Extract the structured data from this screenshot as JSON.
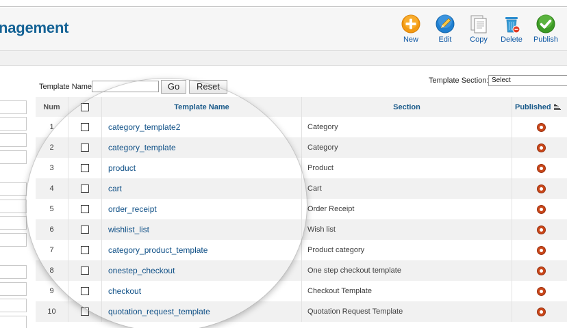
{
  "header": {
    "title": "nagement"
  },
  "toolbar": {
    "new_label": "New",
    "edit_label": "Edit",
    "copy_label": "Copy",
    "delete_label": "Delete",
    "publish_label": "Publish"
  },
  "filter": {
    "template_name_label": "Template Name:",
    "template_name_value": "",
    "go_label": "Go",
    "reset_label": "Reset",
    "section_label": "Template Section:",
    "section_selected": "Select"
  },
  "table": {
    "headers": {
      "num": "Num",
      "name": "Template Name",
      "section": "Section",
      "published": "Published"
    },
    "rows": [
      {
        "num": "1",
        "name": "category_template2",
        "section": "Category"
      },
      {
        "num": "2",
        "name": "category_template",
        "section": "Category"
      },
      {
        "num": "3",
        "name": "product",
        "section": "Product"
      },
      {
        "num": "4",
        "name": "cart",
        "section": "Cart"
      },
      {
        "num": "5",
        "name": "order_receipt",
        "section": "Order Receipt"
      },
      {
        "num": "6",
        "name": "wishlist_list",
        "section": "Wish list"
      },
      {
        "num": "7",
        "name": "category_product_template",
        "section": "Product category"
      },
      {
        "num": "8",
        "name": "onestep_checkout",
        "section": "One step checkout template"
      },
      {
        "num": "9",
        "name": "checkout",
        "section": "Checkout Template"
      },
      {
        "num": "10",
        "name": "quotation_request_template",
        "section": "Quotation Request Template"
      }
    ]
  },
  "colors": {
    "title": "#146295",
    "link": "#0e4f86",
    "published_dot": "#c9471a",
    "new_icon": "#f39a12",
    "edit_icon": "#1f7fd0",
    "delete_icon": "#3a9fd8",
    "publish_icon": "#3d9b26"
  },
  "icons": {
    "new": "plus-circle-icon",
    "edit": "pencil-icon",
    "copy": "document-copy-icon",
    "delete": "trash-bin-icon",
    "publish": "checkmark-circle-icon",
    "sort": "sort-lines-icon",
    "published": "published-dot-icon"
  }
}
